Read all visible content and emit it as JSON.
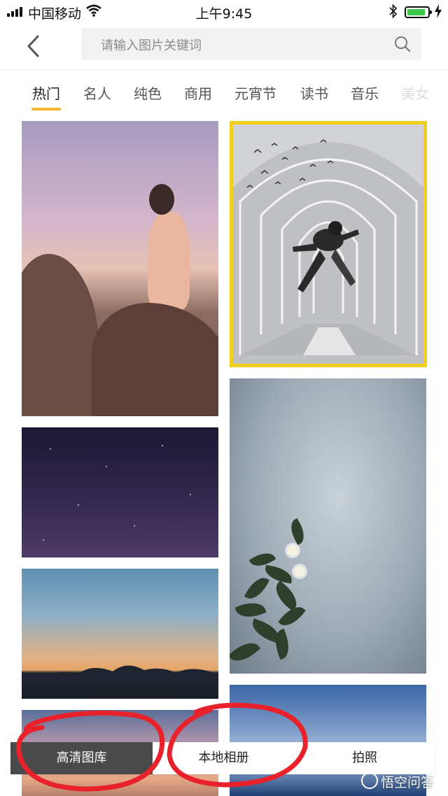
{
  "status_bar": {
    "carrier": "中国移动",
    "time": "上午9:45",
    "battery_level": 0.85,
    "battery_color": "#3cc84a"
  },
  "header": {
    "back_icon": "chevron-left-icon",
    "search_placeholder": "请输入图片关键词",
    "search_icon": "search-icon"
  },
  "tabs": {
    "items": [
      {
        "label": "热门",
        "active": true
      },
      {
        "label": "名人"
      },
      {
        "label": "纯色"
      },
      {
        "label": "商用"
      },
      {
        "label": "元宵节"
      },
      {
        "label": "读书"
      },
      {
        "label": "音乐"
      },
      {
        "label": "美女"
      }
    ],
    "accent_color": "#f5b82a"
  },
  "gallery": {
    "selected_tile_border_color": "#f2cf1d",
    "tiles": [
      "woman-on-rocks-sunset",
      "man-jumping-in-tunnel",
      "purple-night-sky",
      "wall-with-plant-and-flowers",
      "sunset-clouds",
      "pink-sunset-sky",
      "blue-sea-clouds"
    ]
  },
  "bottom_bar": {
    "items": [
      {
        "label": "高清图库",
        "active": true
      },
      {
        "label": "本地相册"
      },
      {
        "label": "拍照"
      }
    ],
    "active_bg": "#4a4a4a"
  },
  "annotation_color": "#e8212b",
  "watermark": {
    "text": "悟空问答"
  }
}
